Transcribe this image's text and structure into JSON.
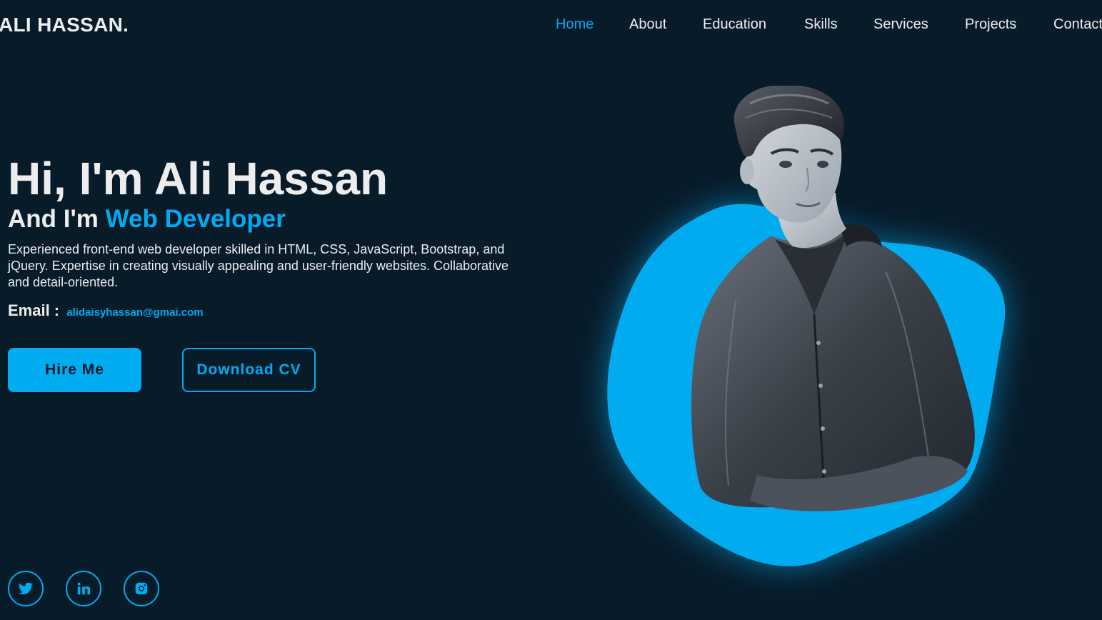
{
  "header": {
    "logo": "ALI HASSAN.",
    "nav": [
      {
        "label": "Home",
        "active": true
      },
      {
        "label": "About",
        "active": false
      },
      {
        "label": "Education",
        "active": false
      },
      {
        "label": "Skills",
        "active": false
      },
      {
        "label": "Services",
        "active": false
      },
      {
        "label": "Projects",
        "active": false
      },
      {
        "label": "Contact",
        "active": false
      }
    ]
  },
  "hero": {
    "heading": "Hi, I'm Ali Hassan",
    "subheading_prefix": "And I'm ",
    "subheading_role": "Web Developer",
    "description": "Experienced front-end web developer skilled in HTML, CSS, JavaScript, Bootstrap, and jQuery. Expertise in creating visually appealing and user-friendly websites. Collaborative and detail-oriented.",
    "email_label": "Email : ",
    "email": "alidaisyhassan@gmai.com",
    "hire_button": "Hire Me",
    "cv_button": "Download CV"
  },
  "socials": [
    {
      "icon": "twitter-icon"
    },
    {
      "icon": "linkedin-icon"
    },
    {
      "icon": "instagram-icon"
    }
  ],
  "colors": {
    "background": "#081b29",
    "accent": "#00abf0",
    "text": "#ededed"
  }
}
